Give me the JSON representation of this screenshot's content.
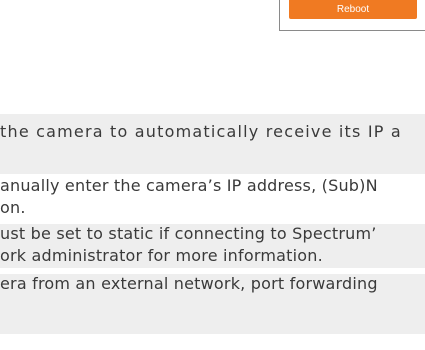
{
  "reboot": {
    "label": "Reboot"
  },
  "notes": {
    "line1": "the camera to automatically receive its IP a",
    "line2": "anually enter the camera’s IP address, (Sub)N",
    "line3": "on.",
    "line4": "ust be set to static if connecting to Spectrum’",
    "line5": "ork administrator for more information.",
    "line6": "era from an external network, port forwarding"
  },
  "colors": {
    "accent": "#f07a22",
    "row_background": "#eeeeee",
    "text": "#3a3a3a"
  }
}
